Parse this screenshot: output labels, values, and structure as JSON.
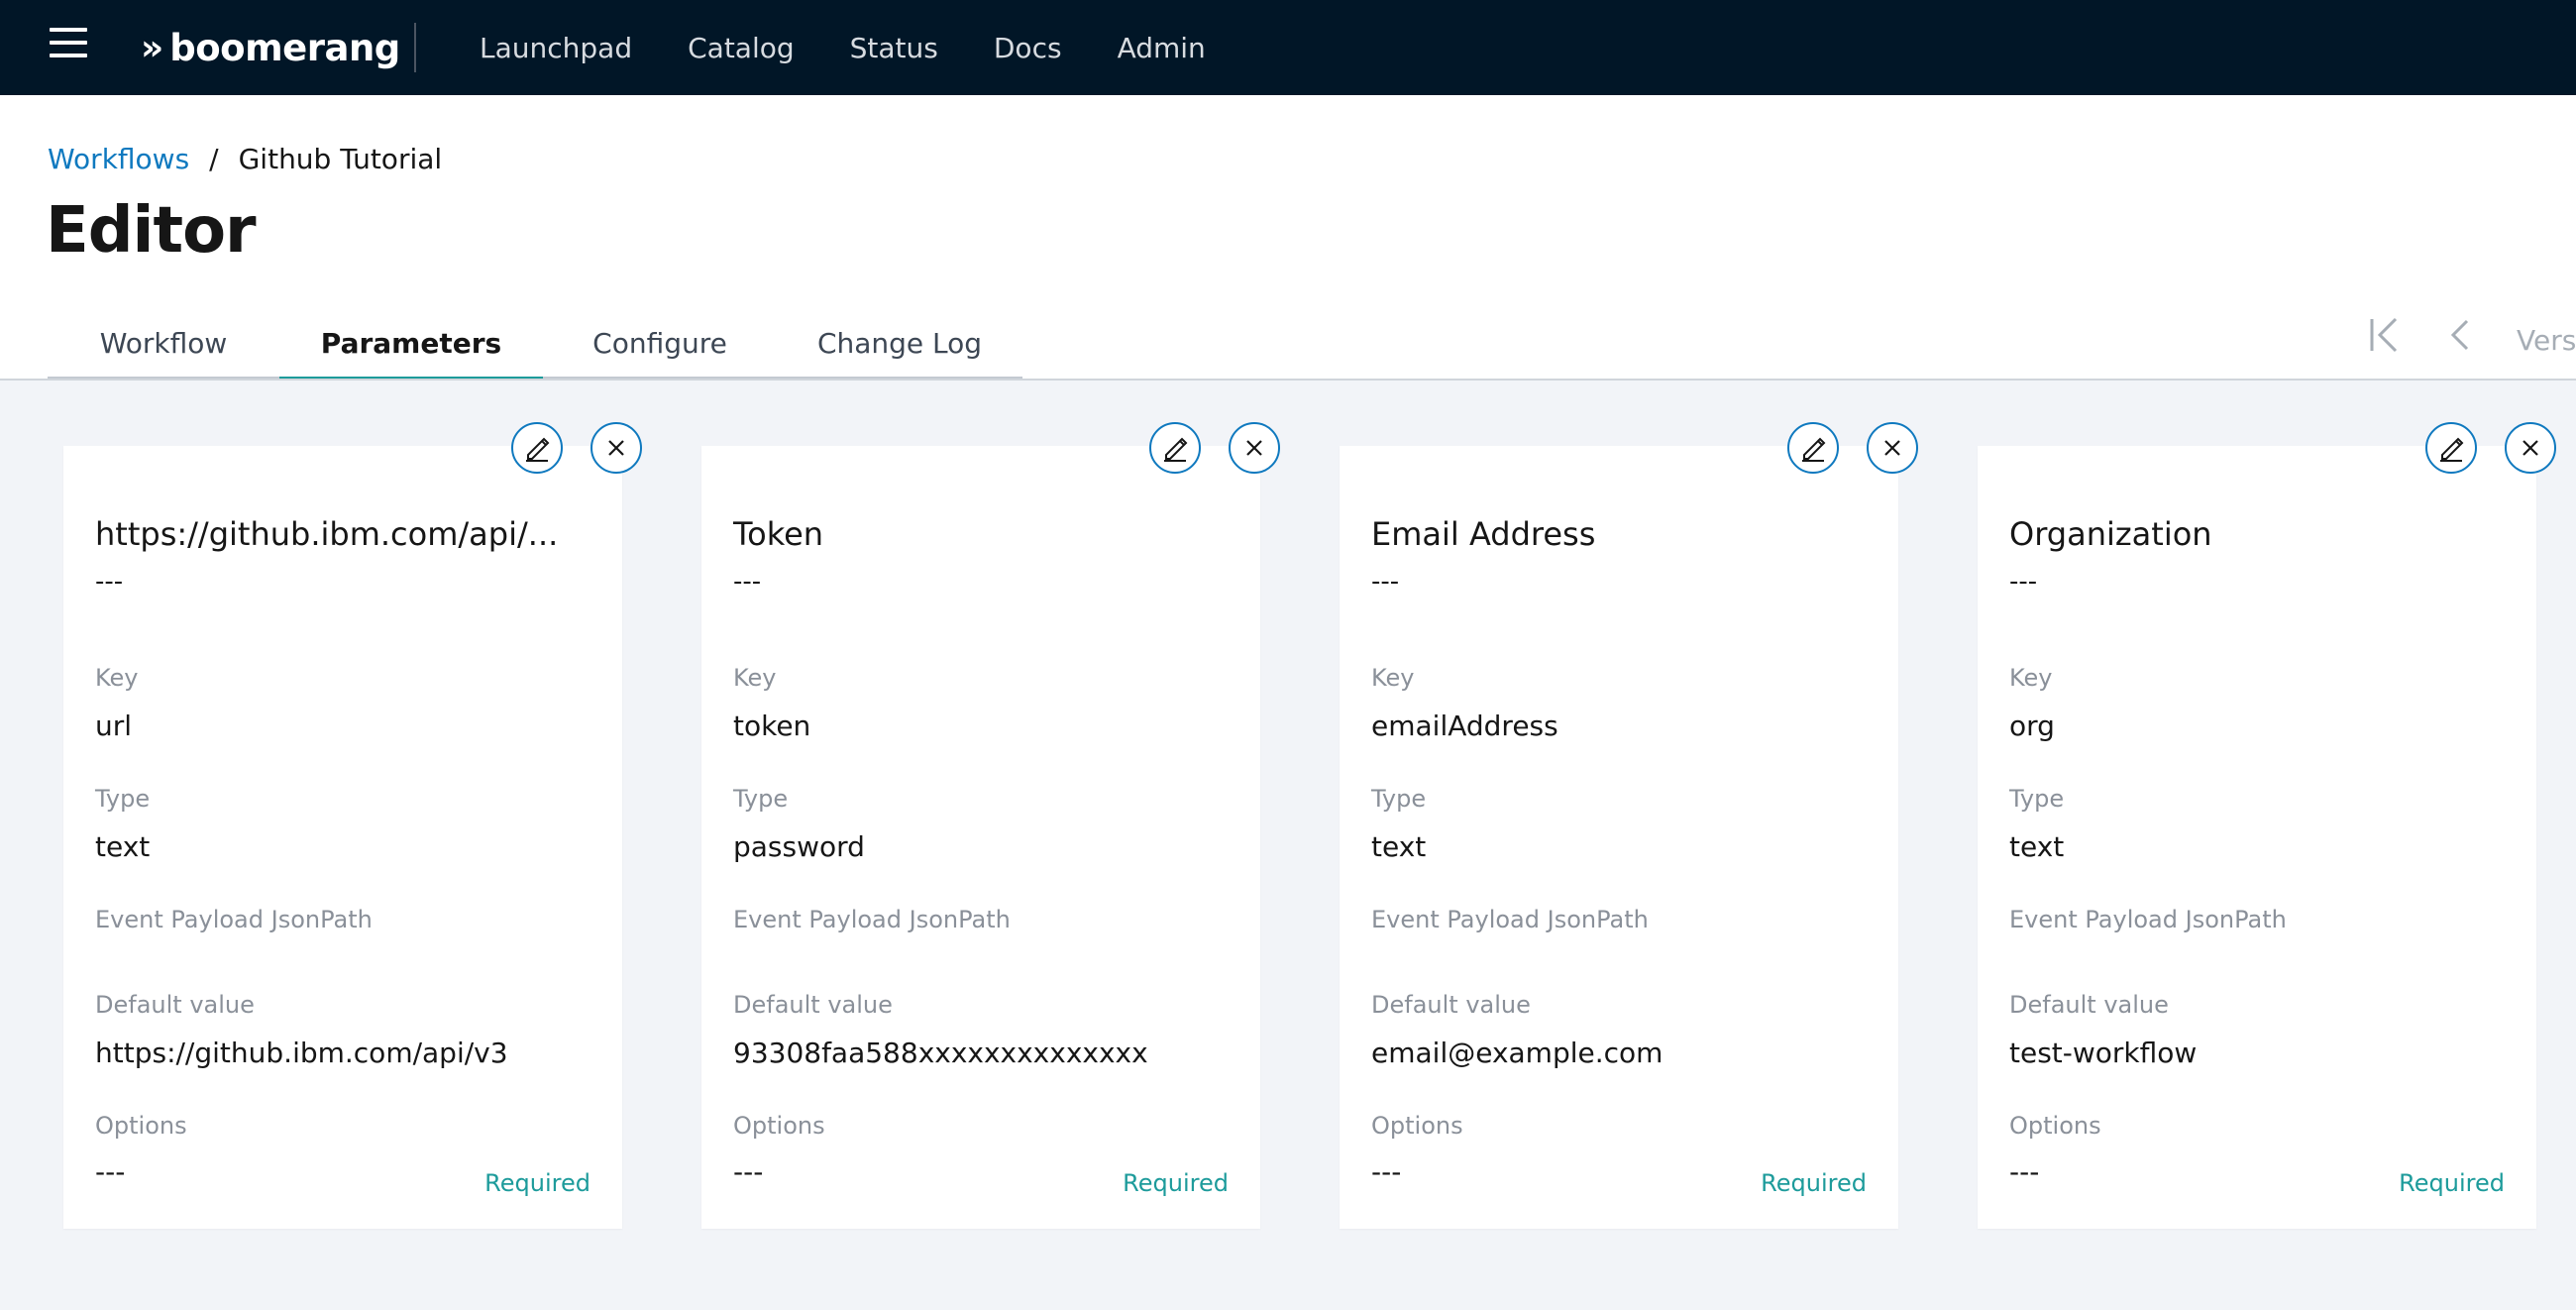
{
  "header": {
    "brand": "boomerang",
    "brand_mark": "»",
    "nav": [
      "Launchpad",
      "Catalog",
      "Status",
      "Docs",
      "Admin"
    ]
  },
  "breadcrumb": {
    "parent": "Workflows",
    "separator": "/",
    "current": "Github Tutorial"
  },
  "page_title": "Editor",
  "tabs": [
    {
      "label": "Workflow",
      "active": false
    },
    {
      "label": "Parameters",
      "active": true
    },
    {
      "label": "Configure",
      "active": false
    },
    {
      "label": "Change Log",
      "active": false
    }
  ],
  "version_nav": {
    "label": "Versi"
  },
  "field_labels": {
    "key": "Key",
    "type": "Type",
    "jsonpath": "Event Payload JsonPath",
    "default": "Default value",
    "options": "Options"
  },
  "cards": [
    {
      "title": "https://github.ibm.com/api/...",
      "description": "---",
      "key": "url",
      "type": "text",
      "jsonpath": "",
      "default": "https://github.ibm.com/api/v3",
      "options": "---",
      "required": "Required"
    },
    {
      "title": "Token",
      "description": "---",
      "key": "token",
      "type": "password",
      "jsonpath": "",
      "default": "93308faa588xxxxxxxxxxxxxx",
      "options": "---",
      "required": "Required"
    },
    {
      "title": "Email Address",
      "description": "---",
      "key": "emailAddress",
      "type": "text",
      "jsonpath": "",
      "default": "email@example.com",
      "options": "---",
      "required": "Required"
    },
    {
      "title": "Organization",
      "description": "---",
      "key": "org",
      "type": "text",
      "jsonpath": "",
      "default": "test-workflow",
      "options": "---",
      "required": "Required"
    }
  ],
  "colors": {
    "header_bg": "#011627",
    "link": "#0f79bf",
    "accent": "#1d9b9b",
    "page_bg": "#f2f4f8"
  }
}
